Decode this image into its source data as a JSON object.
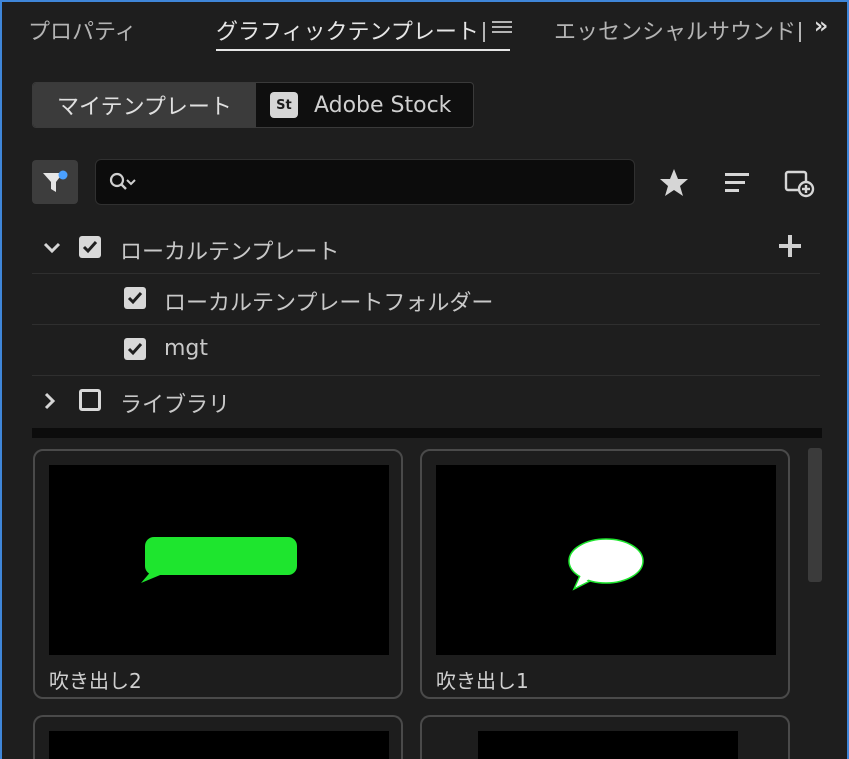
{
  "tabs": [
    {
      "label": "プロパティ",
      "active": false
    },
    {
      "label": "グラフィックテンプレート",
      "active": true
    },
    {
      "label": "エッセンシャルサウンド",
      "active": false
    }
  ],
  "template_source": {
    "options": [
      "マイテンプレート",
      "Adobe Stock"
    ],
    "selected": "マイテンプレート",
    "stock_badge": "St"
  },
  "search": {
    "value": "",
    "placeholder": ""
  },
  "tree": {
    "local": {
      "label": "ローカルテンプレート",
      "checked": true,
      "expanded": true
    },
    "children": [
      {
        "label": "ローカルテンプレートフォルダー",
        "checked": true
      },
      {
        "label": "mgt",
        "checked": true
      }
    ],
    "library": {
      "label": "ライブラリ",
      "checked": false,
      "expanded": false
    }
  },
  "templates": [
    {
      "title": "吹き出し2",
      "preview": "green-rounded-speech-bubble"
    },
    {
      "title": "吹き出し1",
      "preview": "white-oval-speech-bubble"
    }
  ],
  "colors": {
    "accent": "#3f86d9",
    "bubble_green": "#1ee52e",
    "bubble_white": "#ffffff",
    "filter_dot": "#4aa0ff"
  }
}
